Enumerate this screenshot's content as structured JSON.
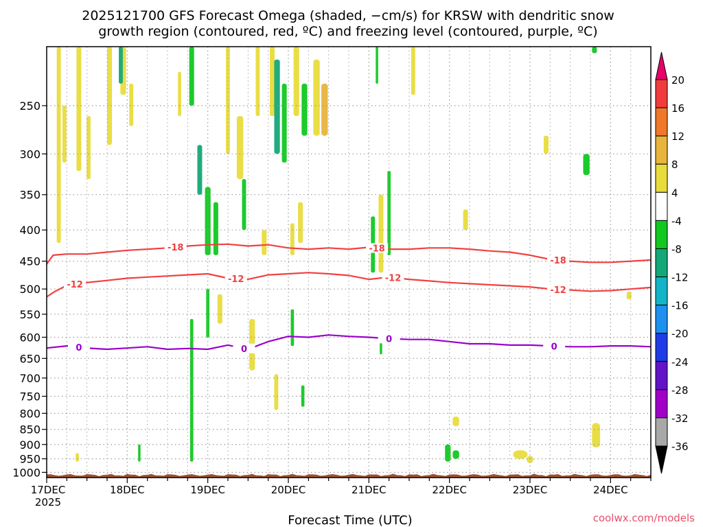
{
  "title_line1": "2025121700 GFS Forecast Omega (shaded, −cm/s) for KRSW with dendritic snow",
  "title_line2": "growth region (contoured, red, ºC) and freezing level (contoured, purple, ºC)",
  "x_axis_title": "Forecast Time (UTC)",
  "year_label": "2025",
  "credit": "coolwx.com/models",
  "colors": {
    "dgz_contour": "#f04040",
    "freezing_contour": "#9a00cc",
    "terrain": "#a0522d",
    "grid": "#999999",
    "frame": "#000000"
  },
  "chart_data": {
    "type": "heatmap",
    "title": "2025121700 GFS Forecast Omega (shaded, −cm/s) for KRSW with dendritic snow growth region (contoured, red, ºC) and freezing level (contoured, purple, ºC)",
    "xlabel": "Forecast Time (UTC)",
    "ylabel": "",
    "x_ticks": [
      "17DEC",
      "18DEC",
      "19DEC",
      "20DEC",
      "21DEC",
      "22DEC",
      "23DEC",
      "24DEC"
    ],
    "xlim_days": [
      17.0,
      24.5
    ],
    "y_ticks": [
      250,
      300,
      350,
      400,
      450,
      500,
      550,
      600,
      650,
      700,
      750,
      800,
      850,
      900,
      950,
      1000
    ],
    "ylim_hpa": [
      1020,
      200
    ],
    "y_scale": "log",
    "grid": true,
    "colorbar": {
      "labels": [
        "20",
        "16",
        "12",
        "8",
        "4",
        "-4",
        "-8",
        "-12",
        "-16",
        "-20",
        "-24",
        "-28",
        "-32",
        "-36"
      ],
      "colors": [
        "#e8006a",
        "#f03c3c",
        "#f07828",
        "#e8b43c",
        "#e8dc3c",
        "#ffffff",
        "#10c820",
        "#14a878",
        "#14b4c8",
        "#1e90f0",
        "#1e3ce6",
        "#6414c8",
        "#a000c8",
        "#a8a8a8",
        "#000000"
      ]
    },
    "series": [
      {
        "name": "-18",
        "color": "#f04040",
        "x": [
          17.0,
          17.08,
          17.25,
          17.5,
          17.75,
          18.0,
          18.25,
          18.5,
          18.75,
          19.0,
          19.25,
          19.5,
          19.75,
          20.0,
          20.25,
          20.5,
          20.75,
          21.0,
          21.25,
          21.5,
          21.75,
          22.0,
          22.25,
          22.5,
          22.75,
          23.0,
          23.25,
          23.5,
          23.75,
          24.0,
          24.25,
          24.5
        ],
        "y": [
          455,
          440,
          438,
          438,
          435,
          432,
          430,
          428,
          425,
          423,
          422,
          425,
          423,
          428,
          430,
          428,
          430,
          427,
          430,
          430,
          428,
          428,
          430,
          433,
          435,
          440,
          447,
          450,
          452,
          452,
          450,
          448
        ],
        "labels": [
          {
            "text": "-18",
            "x": 18.6
          },
          {
            "text": "-18",
            "x": 21.1
          },
          {
            "text": "-18",
            "x": 23.35
          }
        ]
      },
      {
        "name": "-12",
        "color": "#f04040",
        "x": [
          17.0,
          17.1,
          17.25,
          17.5,
          17.75,
          18.0,
          18.25,
          18.5,
          18.75,
          19.0,
          19.25,
          19.5,
          19.75,
          20.0,
          20.25,
          20.5,
          20.75,
          21.0,
          21.25,
          21.5,
          21.75,
          22.0,
          22.25,
          22.5,
          22.75,
          23.0,
          23.25,
          23.5,
          23.75,
          24.0,
          24.25,
          24.5
        ],
        "y": [
          515,
          505,
          493,
          488,
          484,
          480,
          478,
          476,
          474,
          472,
          480,
          482,
          474,
          472,
          470,
          472,
          475,
          482,
          478,
          482,
          485,
          488,
          490,
          492,
          494,
          496,
          500,
          502,
          504,
          503,
          500,
          497
        ],
        "labels": [
          {
            "text": "-12",
            "x": 17.35
          },
          {
            "text": "-12",
            "x": 19.35
          },
          {
            "text": "-12",
            "x": 21.3
          },
          {
            "text": "-12",
            "x": 23.35
          }
        ]
      },
      {
        "name": "0",
        "color": "#9a00cc",
        "x": [
          17.0,
          17.25,
          17.5,
          17.75,
          18.0,
          18.25,
          18.5,
          18.75,
          19.0,
          19.25,
          19.5,
          19.75,
          20.0,
          20.25,
          20.5,
          20.75,
          21.0,
          21.25,
          21.5,
          21.75,
          22.0,
          22.25,
          22.5,
          22.75,
          23.0,
          23.25,
          23.5,
          23.75,
          24.0,
          24.25,
          24.5
        ],
        "y": [
          625,
          620,
          625,
          628,
          625,
          622,
          628,
          626,
          628,
          618,
          628,
          610,
          598,
          600,
          595,
          598,
          600,
          603,
          605,
          605,
          610,
          615,
          615,
          618,
          618,
          620,
          622,
          622,
          620,
          620,
          622
        ],
        "labels": [
          {
            "text": "0",
            "x": 17.4
          },
          {
            "text": "0",
            "x": 19.45
          },
          {
            "text": "0",
            "x": 21.25
          },
          {
            "text": "0",
            "x": 23.3
          }
        ]
      }
    ],
    "omega_cells": [
      {
        "x": 17.15,
        "w": 0.05,
        "p_top": 200,
        "p_bot": 420,
        "v": 6
      },
      {
        "x": 17.22,
        "w": 0.05,
        "p_top": 250,
        "p_bot": 310,
        "v": 6
      },
      {
        "x": 17.4,
        "w": 0.06,
        "p_top": 200,
        "p_bot": 320,
        "v": 6
      },
      {
        "x": 17.52,
        "w": 0.05,
        "p_top": 260,
        "p_bot": 330,
        "v": 6
      },
      {
        "x": 17.78,
        "w": 0.06,
        "p_top": 200,
        "p_bot": 290,
        "v": 6
      },
      {
        "x": 17.95,
        "w": 0.07,
        "p_top": 200,
        "p_bot": 240,
        "v": 6
      },
      {
        "x": 17.92,
        "w": 0.05,
        "p_top": 200,
        "p_bot": 230,
        "v": -10
      },
      {
        "x": 18.05,
        "w": 0.05,
        "p_top": 230,
        "p_bot": 270,
        "v": 6
      },
      {
        "x": 18.65,
        "w": 0.04,
        "p_top": 220,
        "p_bot": 260,
        "v": 6
      },
      {
        "x": 18.8,
        "w": 0.06,
        "p_top": 200,
        "p_bot": 250,
        "v": -6
      },
      {
        "x": 18.9,
        "w": 0.06,
        "p_top": 290,
        "p_bot": 350,
        "v": -10
      },
      {
        "x": 19.0,
        "w": 0.07,
        "p_top": 340,
        "p_bot": 440,
        "v": -6
      },
      {
        "x": 19.1,
        "w": 0.06,
        "p_top": 360,
        "p_bot": 440,
        "v": -6
      },
      {
        "x": 19.25,
        "w": 0.05,
        "p_top": 200,
        "p_bot": 300,
        "v": 6
      },
      {
        "x": 19.4,
        "w": 0.08,
        "p_top": 260,
        "p_bot": 330,
        "v": 6
      },
      {
        "x": 19.45,
        "w": 0.05,
        "p_top": 330,
        "p_bot": 400,
        "v": -6
      },
      {
        "x": 19.62,
        "w": 0.05,
        "p_top": 200,
        "p_bot": 260,
        "v": 6
      },
      {
        "x": 19.8,
        "w": 0.06,
        "p_top": 200,
        "p_bot": 260,
        "v": 6
      },
      {
        "x": 19.86,
        "w": 0.07,
        "p_top": 210,
        "p_bot": 300,
        "v": -10
      },
      {
        "x": 19.95,
        "w": 0.06,
        "p_top": 230,
        "p_bot": 310,
        "v": -6
      },
      {
        "x": 20.1,
        "w": 0.07,
        "p_top": 200,
        "p_bot": 260,
        "v": 6
      },
      {
        "x": 20.2,
        "w": 0.07,
        "p_top": 230,
        "p_bot": 280,
        "v": -6
      },
      {
        "x": 20.35,
        "w": 0.08,
        "p_top": 210,
        "p_bot": 280,
        "v": 6
      },
      {
        "x": 20.45,
        "w": 0.08,
        "p_top": 230,
        "p_bot": 280,
        "v": 10
      },
      {
        "x": 20.15,
        "w": 0.06,
        "p_top": 360,
        "p_bot": 420,
        "v": 6
      },
      {
        "x": 20.05,
        "w": 0.05,
        "p_top": 390,
        "p_bot": 440,
        "v": 6
      },
      {
        "x": 19.7,
        "w": 0.06,
        "p_top": 400,
        "p_bot": 440,
        "v": 6
      },
      {
        "x": 21.05,
        "w": 0.05,
        "p_top": 380,
        "p_bot": 470,
        "v": -6
      },
      {
        "x": 21.15,
        "w": 0.06,
        "p_top": 350,
        "p_bot": 470,
        "v": 6
      },
      {
        "x": 21.25,
        "w": 0.04,
        "p_top": 320,
        "p_bot": 440,
        "v": -6
      },
      {
        "x": 21.1,
        "w": 0.03,
        "p_top": 200,
        "p_bot": 230,
        "v": -6
      },
      {
        "x": 21.55,
        "w": 0.05,
        "p_top": 200,
        "p_bot": 240,
        "v": 6
      },
      {
        "x": 22.2,
        "w": 0.06,
        "p_top": 370,
        "p_bot": 400,
        "v": 6
      },
      {
        "x": 23.2,
        "w": 0.06,
        "p_top": 280,
        "p_bot": 300,
        "v": 6
      },
      {
        "x": 23.7,
        "w": 0.08,
        "p_top": 300,
        "p_bot": 325,
        "v": -6
      },
      {
        "x": 23.8,
        "w": 0.06,
        "p_top": 200,
        "p_bot": 205,
        "v": -6
      },
      {
        "x": 18.8,
        "w": 0.04,
        "p_top": 560,
        "p_bot": 960,
        "v": -6
      },
      {
        "x": 19.0,
        "w": 0.04,
        "p_top": 500,
        "p_bot": 600,
        "v": -6
      },
      {
        "x": 19.15,
        "w": 0.06,
        "p_top": 510,
        "p_bot": 570,
        "v": 6
      },
      {
        "x": 19.55,
        "w": 0.07,
        "p_top": 560,
        "p_bot": 680,
        "v": 6
      },
      {
        "x": 19.85,
        "w": 0.05,
        "p_top": 690,
        "p_bot": 790,
        "v": 6
      },
      {
        "x": 20.05,
        "w": 0.04,
        "p_top": 540,
        "p_bot": 620,
        "v": -6
      },
      {
        "x": 20.18,
        "w": 0.04,
        "p_top": 720,
        "p_bot": 780,
        "v": -6
      },
      {
        "x": 21.15,
        "w": 0.03,
        "p_top": 600,
        "p_bot": 640,
        "v": -6
      },
      {
        "x": 21.98,
        "w": 0.07,
        "p_top": 900,
        "p_bot": 960,
        "v": -6
      },
      {
        "x": 22.08,
        "w": 0.08,
        "p_top": 920,
        "p_bot": 950,
        "v": -6
      },
      {
        "x": 22.08,
        "w": 0.08,
        "p_top": 810,
        "p_bot": 840,
        "v": 6
      },
      {
        "x": 22.88,
        "w": 0.18,
        "p_top": 920,
        "p_bot": 950,
        "v": 6
      },
      {
        "x": 23.0,
        "w": 0.08,
        "p_top": 940,
        "p_bot": 965,
        "v": 6
      },
      {
        "x": 23.82,
        "w": 0.1,
        "p_top": 830,
        "p_bot": 910,
        "v": 6
      },
      {
        "x": 24.23,
        "w": 0.06,
        "p_top": 505,
        "p_bot": 520,
        "v": 6
      },
      {
        "x": 17.38,
        "w": 0.04,
        "p_top": 930,
        "p_bot": 960,
        "v": 6
      },
      {
        "x": 18.15,
        "w": 0.03,
        "p_top": 900,
        "p_bot": 960,
        "v": -6
      }
    ]
  }
}
